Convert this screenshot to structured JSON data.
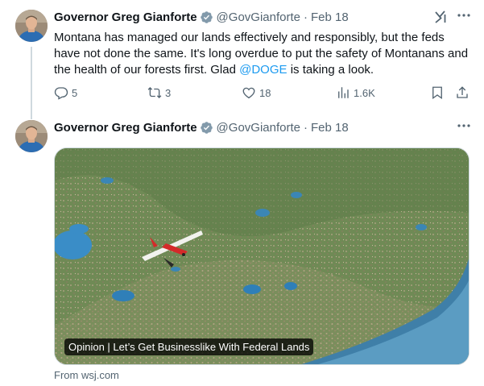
{
  "tweet1": {
    "name": "Governor Greg Gianforte",
    "handle": "@GovGianforte",
    "separator": "·",
    "date": "Feb 18",
    "text_before": "Montana has managed our lands effectively and responsibly, but the feds have not done the same. It's long overdue to put the safety of Montanans and the health of our forests first. Glad ",
    "mention": "@DOGE",
    "text_after": " is taking a look.",
    "replies": "5",
    "reposts": "3",
    "likes": "18",
    "views": "1.6K"
  },
  "tweet2": {
    "name": "Governor Greg Gianforte",
    "handle": "@GovGianforte",
    "separator": "·",
    "date": "Feb 18",
    "card_title": "Opinion | Let’s Get Businesslike With Federal Lands",
    "card_source": "From wsj.com"
  },
  "colors": {
    "accent": "#1d9bf0",
    "secondary_text": "#536471",
    "verified": "#829aab"
  }
}
